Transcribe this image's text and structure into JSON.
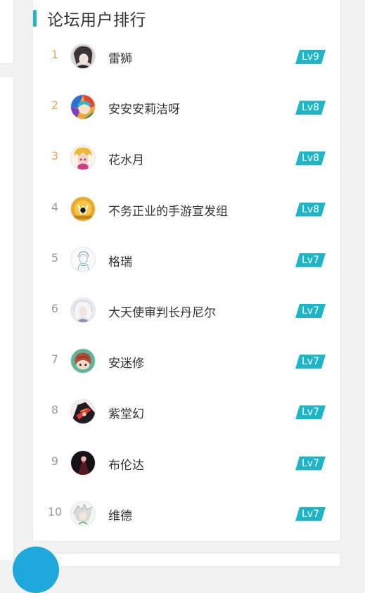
{
  "panel": {
    "title": "论坛用户排行",
    "accent_color": "#1cb6c8"
  },
  "users": [
    {
      "rank": "1",
      "name": "雷狮",
      "level": "Lv9",
      "avatar": "anime-avatar-dark-hair"
    },
    {
      "rank": "2",
      "name": "安安安莉洁呀",
      "level": "Lv8",
      "avatar": "anime-avatar-colorful"
    },
    {
      "rank": "3",
      "name": "花水月",
      "level": "Lv8",
      "avatar": "anime-avatar-blonde-pink"
    },
    {
      "rank": "4",
      "name": "不务正业的手游宣发组",
      "level": "Lv8",
      "avatar": "yellow-logo-avatar"
    },
    {
      "rank": "5",
      "name": "格瑞",
      "level": "Lv7",
      "avatar": "sketch-avatar-white"
    },
    {
      "rank": "6",
      "name": "大天使审判长丹尼尔",
      "level": "Lv7",
      "avatar": "anime-avatar-white-hair"
    },
    {
      "rank": "7",
      "name": "安迷修",
      "level": "Lv7",
      "avatar": "chibi-avatar-teal"
    },
    {
      "rank": "8",
      "name": "紫堂幻",
      "level": "Lv7",
      "avatar": "anime-avatar-red-dark"
    },
    {
      "rank": "9",
      "name": "布伦达",
      "level": "Lv7",
      "avatar": "anime-avatar-dark-red"
    },
    {
      "rank": "10",
      "name": "维德",
      "level": "Lv7",
      "avatar": "anime-avatar-silver-hair"
    }
  ],
  "colors": {
    "rank_top": "#f0a35e",
    "rank_normal": "#999999",
    "level_badge": "#1eb5c6"
  }
}
